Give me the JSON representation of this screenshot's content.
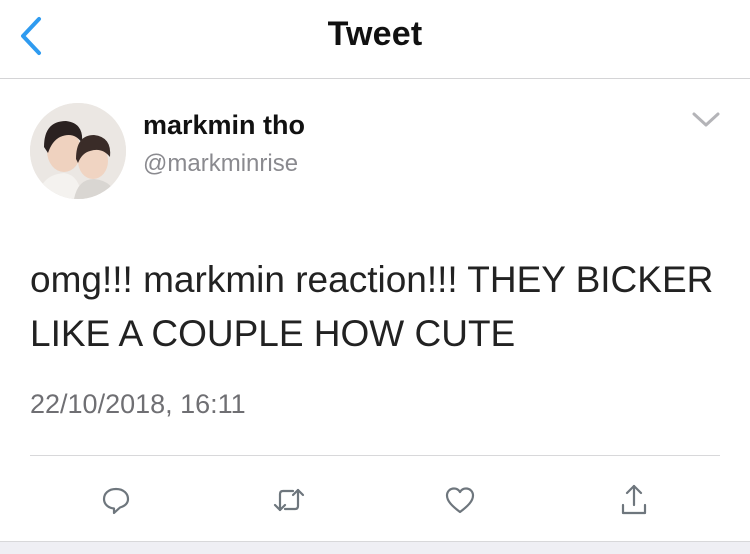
{
  "header": {
    "title": "Tweet",
    "back_icon": "chevron-left-icon",
    "accent_color": "#2f9bf0"
  },
  "tweet": {
    "display_name": "markmin tho",
    "handle": "@markminrise",
    "text": "omg!!! markmin reaction!!! THEY BICKER LIKE A COUPLE HOW CUTE",
    "timestamp": "22/10/2018, 16:11",
    "menu_icon": "chevron-down-icon"
  },
  "actions": [
    {
      "name": "reply",
      "icon": "speech-bubble-icon"
    },
    {
      "name": "retweet",
      "icon": "retweet-arrows-icon"
    },
    {
      "name": "like",
      "icon": "heart-icon"
    },
    {
      "name": "share",
      "icon": "share-upload-icon"
    }
  ]
}
